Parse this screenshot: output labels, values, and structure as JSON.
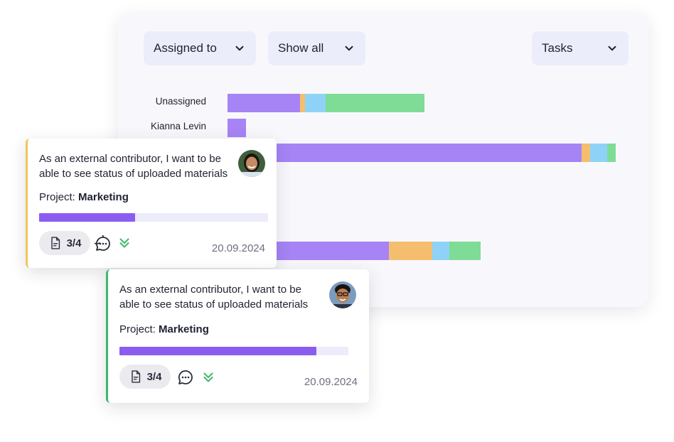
{
  "filters": {
    "assigned": "Assigned to",
    "show": "Show all",
    "tasks": "Tasks"
  },
  "colors": {
    "purple": "#a684f5",
    "orange": "#f5be6e",
    "blue": "#8ed3f7",
    "green": "#7fdc96",
    "card1_accent": "#f3c55a",
    "card2_accent": "#3fb86b"
  },
  "rows": [
    {
      "label": "Unassigned",
      "segments": [
        102,
        7,
        29,
        139
      ]
    },
    {
      "label": "Kianna Levin",
      "segments": [
        26,
        0,
        0,
        0
      ]
    },
    {
      "label": "",
      "segments": [
        498,
        12,
        24,
        12
      ]
    },
    {
      "label": "",
      "segments": [
        227,
        61,
        24,
        44
      ]
    }
  ],
  "cards": [
    {
      "text": "As an external contributor, I want to be able to see status of uploaded materials",
      "project_label": "Project:",
      "project_name": "Marketing",
      "progress": 0.42,
      "subtasks": "3/4",
      "date": "20.09.2024",
      "avatar_icon": "user-avatar-woman",
      "accent": "#f3c55a"
    },
    {
      "text": "As an external contributor, I want to be able to see status of uploaded materials",
      "project_label": "Project:",
      "project_name": "Marketing",
      "progress": 0.86,
      "subtasks": "3/4",
      "date": "20.09.2024",
      "avatar_icon": "user-avatar-man",
      "accent": "#3fb86b"
    }
  ]
}
